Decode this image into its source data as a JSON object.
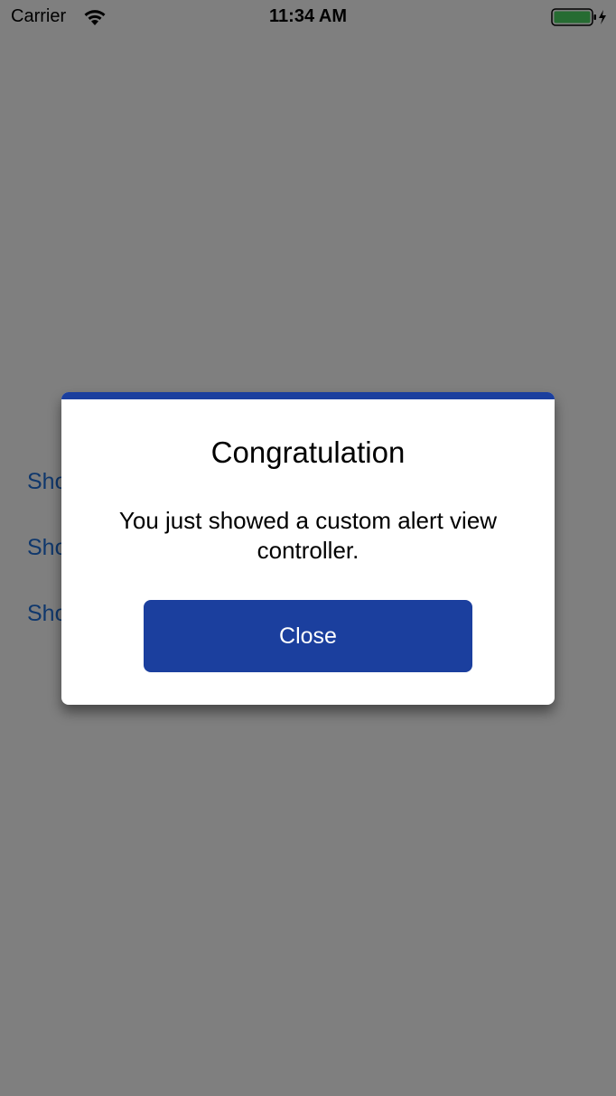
{
  "status_bar": {
    "carrier": "Carrier",
    "time": "11:34 AM",
    "wifi_icon": "wifi-icon",
    "battery_icon": "battery-charging-icon",
    "battery_color": "#4cd964"
  },
  "background": {
    "buttons": [
      {
        "label": "Sho"
      },
      {
        "label": "Sho"
      },
      {
        "label": "Sho"
      }
    ],
    "link_color": "#1f6fd8"
  },
  "alert": {
    "title": "Congratulation",
    "message": "You just showed a custom alert view controller.",
    "close_label": "Close",
    "accent_color": "#1b3f9e"
  }
}
